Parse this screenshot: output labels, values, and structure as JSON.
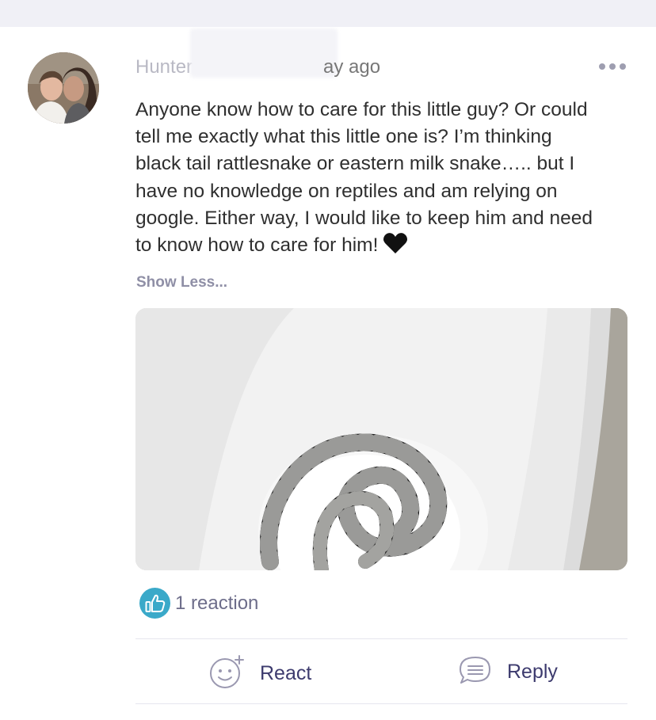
{
  "post": {
    "author": "Hunter",
    "time": "a day ago",
    "time_visible": "ay ago",
    "body": "Anyone know how to care for this little guy? Or could tell me exactly what this little one is? I’m thinking black tail rattlesnake or eastern milk snake….. but I have no knowledge on reptiles and am relying on google. Either way, I would like to keep him and need to know how to care for him!",
    "body_lines": [
      "Anyone know how to care for this little guy? Or could",
      "tell me exactly what this little one is? I’m thinking",
      "black tail rattlesnake or eastern milk snake….. but I",
      "have no knowledge on reptiles and am relying on",
      "google. Either way, I would like to keep him and need",
      "to know how to care for him!"
    ],
    "show_less_label": "Show Less...",
    "reaction_count_label": "1 reaction"
  },
  "actions": {
    "react_label": "React",
    "reply_label": "Reply"
  },
  "icons": {
    "more": "more-options-icon",
    "heart": "black-heart-emoji",
    "like": "thumbs-up-icon",
    "react": "add-reaction-icon",
    "reply": "reply-bubble-icon"
  },
  "colors": {
    "accent": "#3d3b6e",
    "like_badge": "#3aa9c9",
    "muted": "#8f8fa6"
  }
}
